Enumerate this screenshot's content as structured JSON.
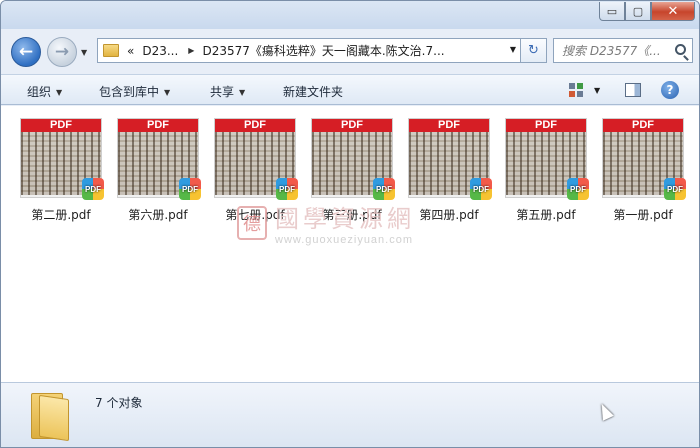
{
  "window": {
    "min_glyph": "▭",
    "max_glyph": "▢",
    "close_glyph": "✕"
  },
  "nav": {
    "back_glyph": "←",
    "forward_glyph": "→",
    "dropdown_glyph": "▼"
  },
  "address": {
    "prefix": "«",
    "crumbs": [
      "D23...",
      "D23577《瘍科选粹》天一阁藏本.陈文治.7..."
    ],
    "sep_glyph": "▶",
    "dropdown_glyph": "▼",
    "refresh_glyph": "↻"
  },
  "search": {
    "placeholder": "搜索 D23577《..."
  },
  "toolbar": {
    "organize": "组织",
    "include_library": "包含到库中",
    "share": "共享",
    "new_folder": "新建文件夹",
    "arrow_glyph": "▼",
    "help_glyph": "?"
  },
  "files": [
    {
      "name": "第二册.pdf",
      "banner": "PDF",
      "badge": "PDF"
    },
    {
      "name": "第六册.pdf",
      "banner": "PDF",
      "badge": "PDF"
    },
    {
      "name": "第七册.pdf",
      "banner": "PDF",
      "badge": "PDF"
    },
    {
      "name": "第三册.pdf",
      "banner": "PDF",
      "badge": "PDF"
    },
    {
      "name": "第四册.pdf",
      "banner": "PDF",
      "badge": "PDF"
    },
    {
      "name": "第五册.pdf",
      "banner": "PDF",
      "badge": "PDF"
    },
    {
      "name": "第一册.pdf",
      "banner": "PDF",
      "badge": "PDF"
    }
  ],
  "watermark": {
    "seal": "德",
    "text": "國學資源網",
    "url": "www.guoxueziyuan.com"
  },
  "status": {
    "count_text": "7 个对象"
  }
}
